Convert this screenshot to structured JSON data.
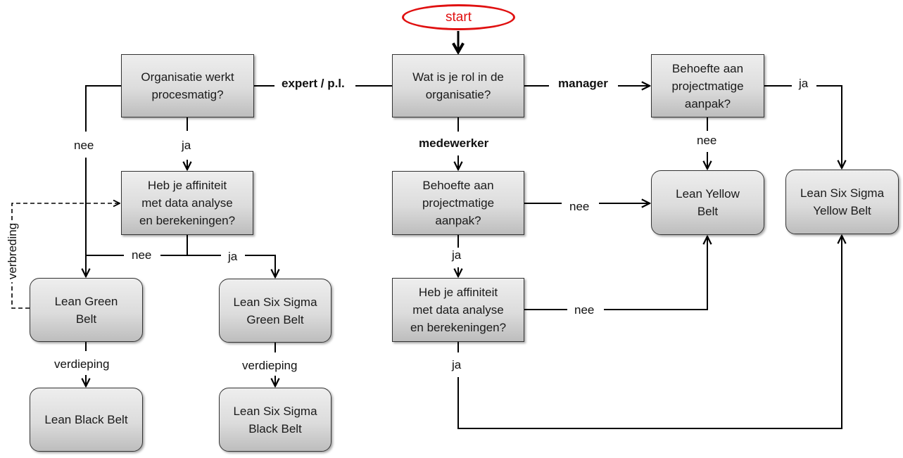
{
  "diagram": {
    "start": "start",
    "nodes": {
      "organisatie": "Organisatie werkt\nprocesmatig?",
      "rol": "Wat is je rol in de\norganisatie?",
      "behoefte_manager": "Behoefte  aan\nprojectmatige\naanpak?",
      "affiniteit_left": "Heb je affiniteit\nmet data analyse\nen berekeningen?",
      "behoefte_medewerker": "Behoefte  aan\nprojectmatige\naanpak?",
      "affiniteit_mid": "Heb je affiniteit\nmet data analyse\nen berekeningen?",
      "lean_yellow": "Lean Yellow\nBelt",
      "lss_yellow": "Lean Six Sigma\nYellow Belt",
      "lean_green": "Lean Green\nBelt",
      "lss_green": "Lean Six Sigma\nGreen Belt",
      "lean_black": "Lean Black Belt",
      "lss_black": "Lean Six Sigma\nBlack Belt"
    },
    "edges": {
      "expert": "expert / p.l.",
      "manager": "manager",
      "medewerker": "medewerker",
      "org_nee": "nee",
      "org_ja": "ja",
      "aff_left_nee": "nee",
      "aff_left_ja": "ja",
      "mgr_ja": "ja",
      "mgr_nee": "nee",
      "mdw_nee": "nee",
      "mdw_ja": "ja",
      "aff_mid_nee": "nee",
      "aff_mid_ja": "ja",
      "green_verdieping": "verdieping",
      "lss_green_verdieping": "verdieping",
      "verbreding": "verbreding"
    },
    "colors": {
      "start": "#e01010",
      "line": "#000000"
    }
  }
}
